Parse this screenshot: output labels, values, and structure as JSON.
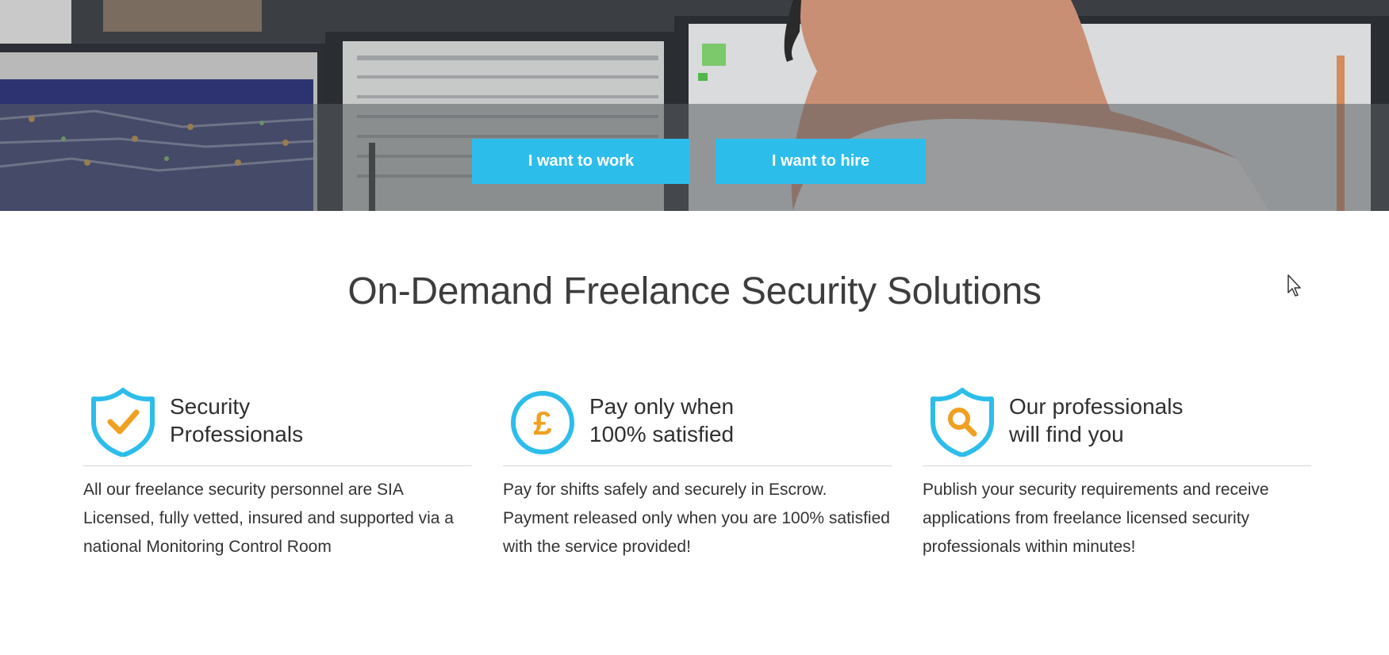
{
  "hero": {
    "buttons": {
      "work_label": "I want to work",
      "hire_label": "I want to hire"
    }
  },
  "main": {
    "title": "On-Demand Freelance Security Solutions",
    "features": [
      {
        "icon": "shield-check-icon",
        "title_line1": "Security",
        "title_line2": "Professionals",
        "description": "All our freelance security personnel are SIA Licensed, fully vetted, insured and supported via a national Monitoring Control Room"
      },
      {
        "icon": "pound-circle-icon",
        "title_line1": "Pay only when",
        "title_line2": "100% satisfied",
        "description": "Pay for shifts safely and securely in Escrow. Payment released only when you are 100% satisfied with the service provided!"
      },
      {
        "icon": "shield-search-icon",
        "title_line1": "Our professionals",
        "title_line2": "will find you",
        "description": "Publish your security requirements and receive applications from freelance licensed security professionals within minutes!"
      }
    ]
  },
  "colors": {
    "accent": "#2dbdeb",
    "icon_highlight": "#f0a020",
    "heading": "#3d3d3d",
    "text": "#333333"
  }
}
